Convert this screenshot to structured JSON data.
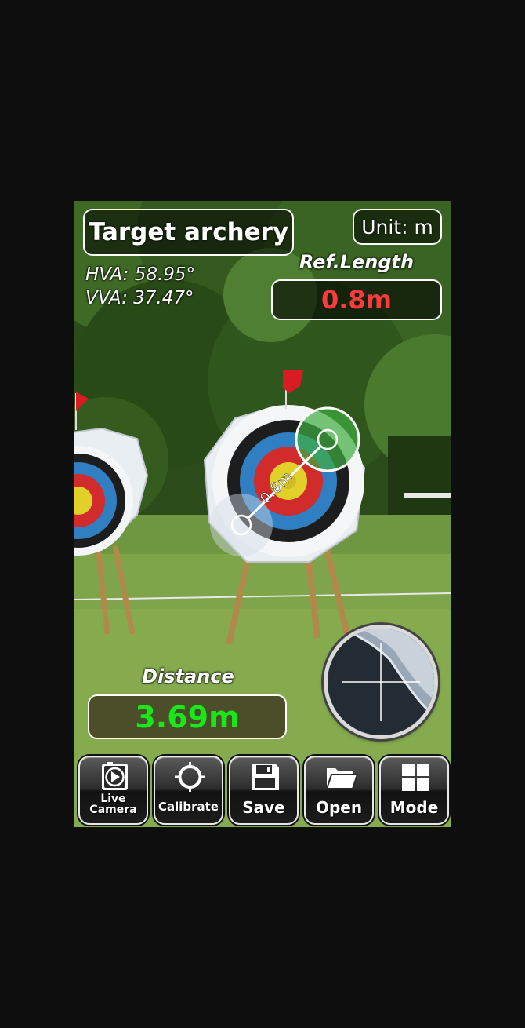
{
  "header": {
    "mode_title": "Target archery",
    "unit_label": "Unit: m"
  },
  "angles": {
    "hva": "HVA: 58.95°",
    "vva": "VVA: 37.47°"
  },
  "reference": {
    "caption": "Ref.Length",
    "value": "0.8m",
    "line_label": "0.8m"
  },
  "distance": {
    "caption": "Distance",
    "value": "3.69m"
  },
  "toolbar": {
    "live_line1": "Live",
    "live_line2": "Camera",
    "calibrate": "Calibrate",
    "save": "Save",
    "open": "Open",
    "mode": "Mode"
  },
  "colors": {
    "reference_value": "#ff3a3a",
    "distance_value": "#18e81a",
    "handle_end": "#3fae3f"
  },
  "icons": [
    "live-camera-icon",
    "calibrate-icon",
    "save-icon",
    "open-folder-icon",
    "mode-grid-icon"
  ]
}
